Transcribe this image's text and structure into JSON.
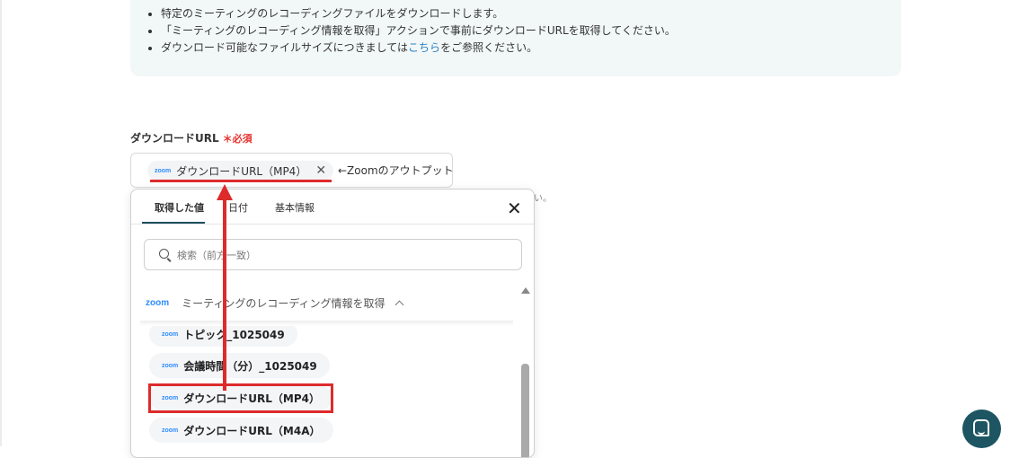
{
  "info": {
    "bullets": [
      "特定のミーティングのレコーディングファイルをダウンロードします。",
      "「ミーティングのレコーディング情報を取得」アクションで事前にダウンロードURLを取得してください。"
    ],
    "bullet3_prefix": "ダウンロード可能なファイルサイズにつきましては",
    "bullet3_link": "こちら",
    "bullet3_suffix": "をご参照ください。"
  },
  "field": {
    "label": "ダウンロードURL",
    "required": "＊必須",
    "chip_label": "ダウンロードURL（MP4）",
    "after_text": "←Zoomのアウトプット",
    "hint_tail": "い。"
  },
  "dropdown": {
    "tabs": [
      "取得した値",
      "日付",
      "基本情報"
    ],
    "search_placeholder": "検索（前方一致）",
    "group_title": "ミーティングのレコーディング情報を取得",
    "items": [
      "トピック_1025049",
      "会議時間（分）_1025049",
      "ダウンロードURL（MP4）",
      "ダウンロードURL（M4A）"
    ]
  },
  "icons": {
    "zoom_logo": "zoom",
    "close": "close-icon",
    "search": "search-icon",
    "chat": "chat-icon"
  },
  "colors": {
    "accent": "#1e5563",
    "annotation_red": "#dd2b2b",
    "link": "#2a7fc1",
    "required": "#e5322d"
  }
}
